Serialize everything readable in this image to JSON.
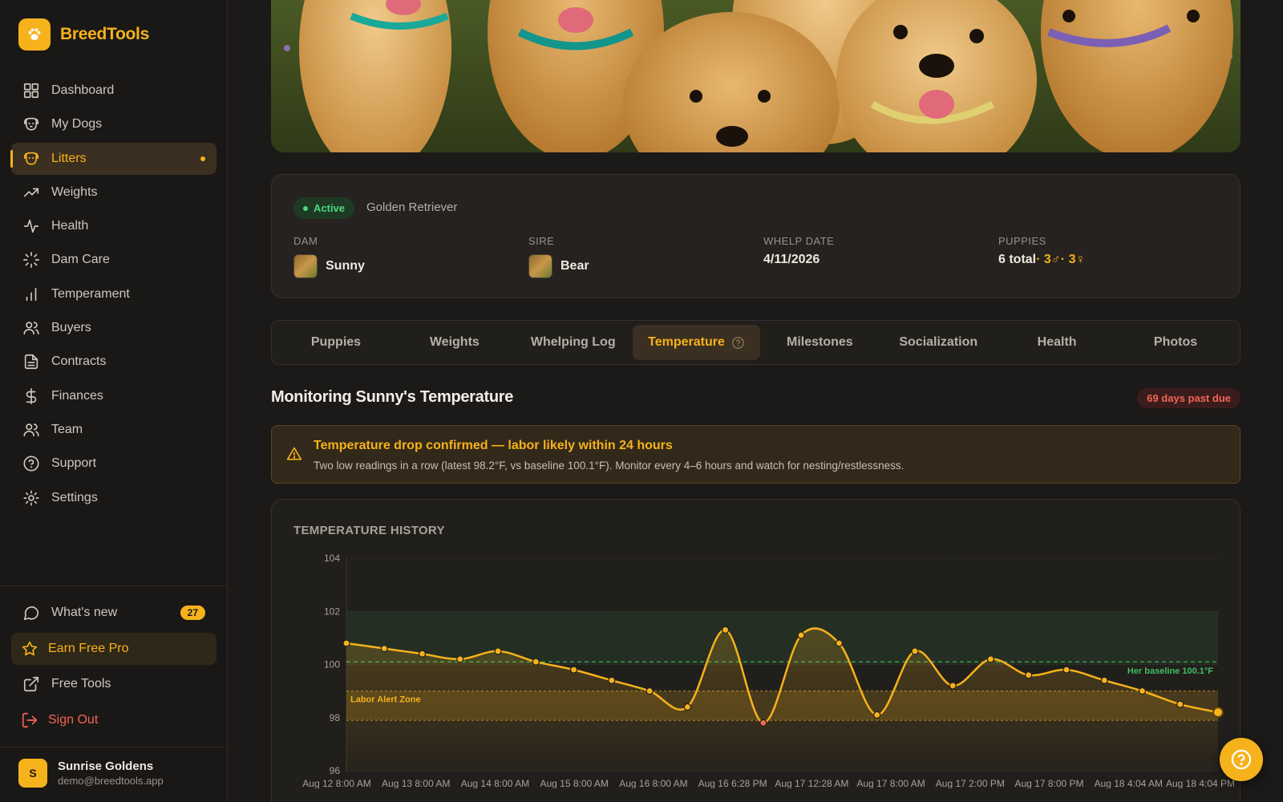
{
  "app": {
    "name": "BreedTools"
  },
  "sidebar": {
    "items": [
      {
        "label": "Dashboard",
        "icon": "grid-icon"
      },
      {
        "label": "My Dogs",
        "icon": "dog-icon"
      },
      {
        "label": "Litters",
        "icon": "litter-icon",
        "active": true
      },
      {
        "label": "Weights",
        "icon": "trend-icon"
      },
      {
        "label": "Health",
        "icon": "pulse-icon"
      },
      {
        "label": "Dam Care",
        "icon": "loader-icon"
      },
      {
        "label": "Temperament",
        "icon": "bar-chart-icon"
      },
      {
        "label": "Buyers",
        "icon": "users-icon"
      },
      {
        "label": "Contracts",
        "icon": "document-icon"
      },
      {
        "label": "Finances",
        "icon": "dollar-icon"
      },
      {
        "label": "Team",
        "icon": "team-icon"
      },
      {
        "label": "Support",
        "icon": "help-circle-icon"
      },
      {
        "label": "Settings",
        "icon": "gear-icon"
      }
    ],
    "whats_new": {
      "label": "What's new",
      "count": "27"
    },
    "earn_pro": "Earn Free Pro",
    "free_tools": "Free Tools",
    "sign_out": "Sign Out",
    "user": {
      "name": "Sunrise Goldens",
      "email": "demo@breedtools.app",
      "initial": "S"
    }
  },
  "litter": {
    "status": "Active",
    "breed": "Golden Retriever",
    "dam": {
      "label": "DAM",
      "name": "Sunny"
    },
    "sire": {
      "label": "SIRE",
      "name": "Bear"
    },
    "whelp": {
      "label": "WHELP DATE",
      "value": "4/11/2026"
    },
    "puppies": {
      "label": "PUPPIES",
      "total": "6 total",
      "male": " · 3♂",
      "female": " · 3♀"
    }
  },
  "tabs": [
    "Puppies",
    "Weights",
    "Whelping Log",
    "Temperature",
    "Milestones",
    "Socialization",
    "Health",
    "Photos"
  ],
  "active_tab": "Temperature",
  "section": {
    "title": "Monitoring Sunny's Temperature",
    "due_badge": "69 days past due"
  },
  "alert": {
    "title": "Temperature drop confirmed — labor likely within 24 hours",
    "text": "Two low readings in a row (latest 98.2°F, vs baseline 100.1°F). Monitor every 4–6 hours and watch for nesting/restlessness."
  },
  "chart_data": {
    "type": "line",
    "title": "TEMPERATURE HISTORY",
    "ylim": [
      96,
      104
    ],
    "yticks": [
      96,
      98,
      100,
      102,
      104
    ],
    "xtick_labels": [
      "Aug 12 8:00 AM",
      "Aug 13 8:00 AM",
      "Aug 14 8:00 AM",
      "Aug 15 8:00 AM",
      "Aug 16 8:00 AM",
      "Aug 16 6:28 PM",
      "Aug 17 12:28 AM",
      "Aug 17 8:00 AM",
      "Aug 17 2:00 PM",
      "Aug 17 8:00 PM",
      "Aug 18 4:04 AM",
      "Aug 18 4:04 PM"
    ],
    "values": [
      100.8,
      100.6,
      100.4,
      100.2,
      100.5,
      100.1,
      99.8,
      99.4,
      99.0,
      98.4,
      101.3,
      97.8,
      101.1,
      100.8,
      98.1,
      100.5,
      99.2,
      100.2,
      99.6,
      99.8,
      99.4,
      99.0,
      98.5,
      98.2
    ],
    "baseline": 100.1,
    "baseline_label": "Her baseline 100.1°F",
    "alert_zone": [
      97.9,
      99.0
    ],
    "alert_zone_label": "Labor Alert Zone",
    "normal_band": [
      100.0,
      102.0
    ],
    "colors": {
      "line": "#f6b21b",
      "baseline": "#3fbf5f",
      "low_point": "#f06656"
    },
    "grid": true
  }
}
